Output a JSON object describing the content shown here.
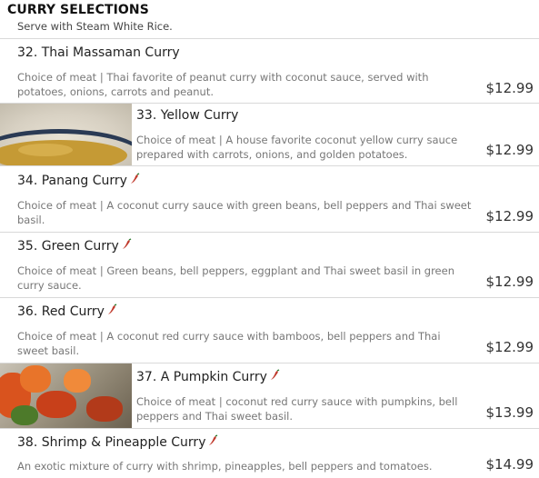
{
  "section": {
    "title": "CURRY SELECTIONS",
    "subtitle": "Serve with Steam White Rice."
  },
  "items": [
    {
      "name": "32. Thai Massaman Curry",
      "spicy": false,
      "has_photo": false,
      "desc": "Choice of meat | Thai favorite of peanut curry with coconut sauce, served with potatoes, onions, carrots and peanut.",
      "price": "$12.99"
    },
    {
      "name": "33. Yellow Curry",
      "spicy": false,
      "has_photo": true,
      "desc": "Choice of meat | A house favorite coconut yellow curry sauce prepared with carrots, onions, and golden potatoes.",
      "price": "$12.99"
    },
    {
      "name": "34. Panang Curry",
      "spicy": true,
      "has_photo": false,
      "desc": "Choice of meat | A coconut curry sauce with green beans, bell peppers and Thai sweet basil.",
      "price": "$12.99"
    },
    {
      "name": "35. Green Curry",
      "spicy": true,
      "has_photo": false,
      "desc": "Choice of meat | Green beans, bell peppers, eggplant and Thai sweet basil in green curry sauce.",
      "price": "$12.99"
    },
    {
      "name": "36. Red Curry",
      "spicy": true,
      "has_photo": false,
      "desc": "Choice of meat | A coconut red curry sauce with bamboos, bell peppers and Thai sweet basil.",
      "price": "$12.99"
    },
    {
      "name": "37. A Pumpkin Curry",
      "spicy": true,
      "has_photo": true,
      "desc": "Choice of meat | coconut red curry sauce with pumpkins, bell peppers and Thai sweet basil.",
      "price": "$13.99"
    },
    {
      "name": "38. Shrimp & Pineapple Curry",
      "spicy": true,
      "has_photo": false,
      "desc": "An exotic mixture of curry with shrimp, pineapples, bell peppers and tomatoes.",
      "price": "$14.99"
    }
  ],
  "icons": {
    "spicy": "chili-pepper-icon"
  },
  "colors": {
    "chili": "#c0392b",
    "divider": "#d9d9d9",
    "desc_text": "#777777"
  }
}
